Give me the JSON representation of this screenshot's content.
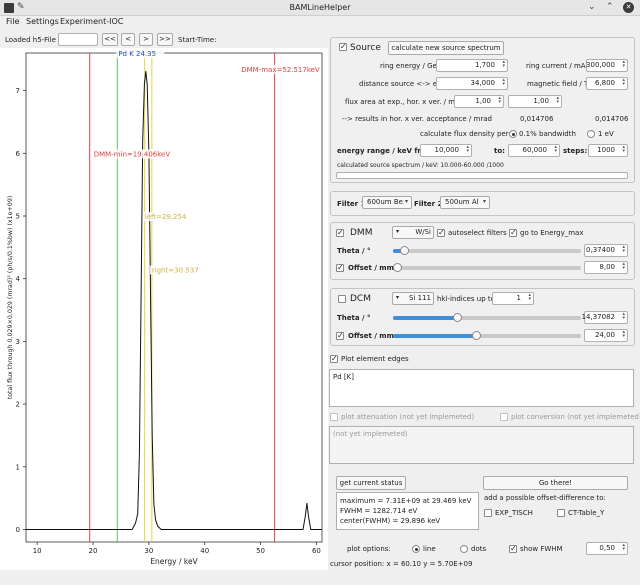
{
  "window": {
    "title": "BAMLineHelper"
  },
  "menu": [
    "File",
    "Settings",
    "Experiment-IOC"
  ],
  "toolbar": {
    "loaded_label": "Loaded h5-File",
    "loaded_value": "",
    "nav": [
      "<<",
      "<",
      ">",
      ">>"
    ],
    "start_time_label": "Start-Time:"
  },
  "chart_data": {
    "type": "line",
    "xlabel": "Energy / keV",
    "ylabel": "total flux through 0.029×0.029 (mrad)² (ph/s/0.1%bw) (x1e+09)",
    "xlim": [
      8,
      61
    ],
    "ylim": [
      -0.2,
      7.6
    ],
    "xticks": [
      10,
      20,
      30,
      40,
      50,
      60
    ],
    "yticks": [
      0,
      1,
      2,
      3,
      4,
      5,
      6,
      7
    ],
    "series": [
      {
        "x": [
          8,
          27.0,
          27.6,
          28.0,
          28.3,
          28.6,
          28.9,
          29.2,
          29.45,
          29.7,
          30.0,
          30.3,
          30.6,
          30.9,
          31.2,
          31.6,
          32.2,
          33,
          57.6,
          58.0,
          58.3,
          58.6,
          59.0,
          61
        ],
        "y": [
          0,
          0,
          0.1,
          0.25,
          1.2,
          3.6,
          6.2,
          7.1,
          7.31,
          7.1,
          6.0,
          3.8,
          1.5,
          0.4,
          0.15,
          0.05,
          0,
          0,
          0,
          0.2,
          0.42,
          0.2,
          0,
          0
        ]
      }
    ],
    "vlines": [
      {
        "x": 19.406,
        "color": "#e04040",
        "label": "DMM-min=19.406keV",
        "label_y": 5.95,
        "label_color": "#e04040"
      },
      {
        "x": 52.517,
        "color": "#e04040",
        "label": "DMM-max=52.517keV",
        "label_y": 7.3,
        "label_color": "#e04040"
      },
      {
        "x": 24.35,
        "color": "#60c060",
        "label": "Pd K 24.35",
        "label_y": 7.55,
        "label_color": "#2050c0"
      },
      {
        "x": 29.254,
        "color": "#e8d040",
        "label": "left=29.254",
        "label_y": 4.95,
        "label_color": "#d0b040"
      },
      {
        "x": 30.537,
        "color": "#e8d040",
        "label": "right=30.537",
        "label_y": 4.1,
        "label_color": "#d0b040"
      }
    ]
  },
  "source": {
    "checkbox_label": "Source",
    "calc_button": "calculate new source spectrum",
    "ring_energy_label": "ring energy / GeV",
    "ring_energy": "1,700",
    "ring_current_label": "ring current / mA",
    "ring_current": "300,000",
    "distance_label": "distance source <-> exp. / m",
    "distance": "34,000",
    "field_label": "magnetic field / T",
    "field": "6,800",
    "flux_area_label": "flux area at exp., hor. x ver. / mm",
    "flux_h": "1,00",
    "flux_v": "1,00",
    "results_label": "--> results in hor. x ver. acceptance / mrad",
    "res_h": "0,014706",
    "res_v": "0,014706",
    "density_label": "calculate flux density per:",
    "opt1": "0.1% bandwidth",
    "opt2": "1 eV",
    "energy_range_label": "energy range / keV from:",
    "from": "10,000",
    "to_label": "to:",
    "to": "60,000",
    "steps_label": "steps:",
    "steps": "1000",
    "spectrum_info": "calculated source spectrum / keV: 10.000-60.000 /1000"
  },
  "filters": {
    "f1_label": "Filter 1",
    "f1": "600um Be",
    "f2_label": "Filter 2",
    "f2": "500um Al"
  },
  "dmm": {
    "label": "DMM",
    "material": "W/Si",
    "autoselect": "autoselect filters",
    "goto": "go to Energy_max",
    "theta_label": "Theta / °",
    "theta": "0,37400",
    "theta_frac": 0.06,
    "offset_label": "Offset / mm",
    "offset": "8,00",
    "offset_frac": 0.02
  },
  "dcm": {
    "label": "DCM",
    "crystal": "Si 111",
    "hkl_label": "hkl-indices up to",
    "hkl": "1",
    "theta_label": "Theta / °",
    "theta": "14,37082",
    "theta_frac": 0.34,
    "offset_label": "Offset / mm",
    "offset": "24,00",
    "offset_frac": 0.44
  },
  "elements": {
    "plot_edges": "Plot element edges",
    "text": "Pd [K]"
  },
  "attenuation": {
    "label": "plot attenuation (not yet implemeted)",
    "conversion": "plot conversion (not yet implemeted)",
    "text": "(not yet implemeted)"
  },
  "status": {
    "get_button": "get current status",
    "go_button": "Go there!",
    "info": "maximum = 7.31E+09 at 29.469 keV\nFWHM = 1282.714 eV\ncenter(FWHM) = 29.896 keV",
    "offset_label": "add a possible offset-difference to:",
    "exp_tisch": "EXP_TISCH",
    "ct_table": "CT-Table_Y"
  },
  "plot_options": {
    "label": "plot options:",
    "line": "line",
    "dots": "dots",
    "show_fwhm": "show FWHM",
    "fwhm_value": "0,50"
  },
  "cursor": "cursor position: x = 60.10 y = 5.70E+09"
}
